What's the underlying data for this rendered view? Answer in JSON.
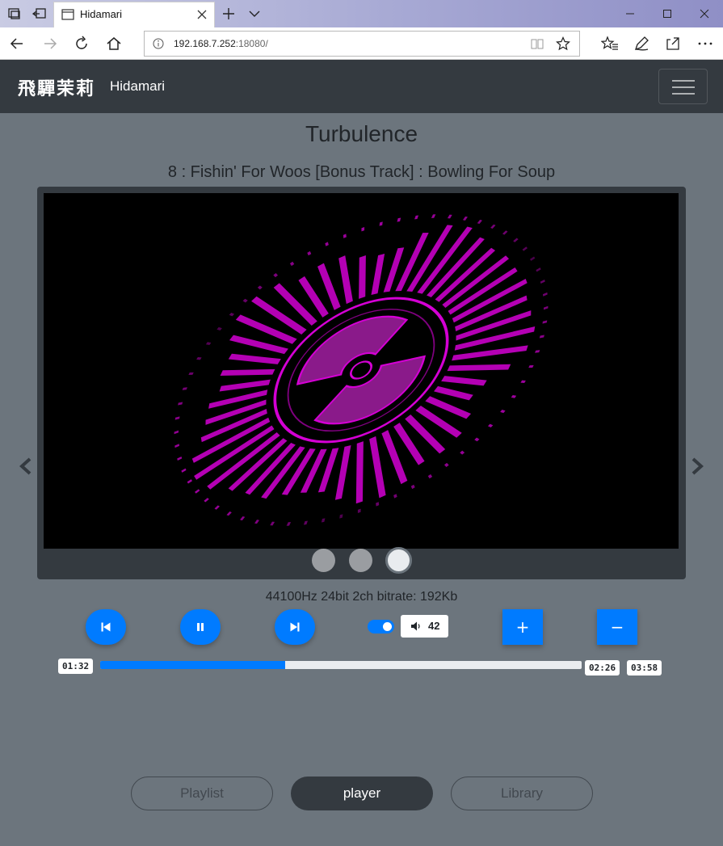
{
  "browser": {
    "tab_title": "Hidamari",
    "url_host": "192.168.7.252",
    "url_port": ":18080/",
    "icons": [
      "tab-manager-icon",
      "set-aside-tabs-icon",
      "page-icon",
      "close-icon",
      "plus-icon",
      "chevron-down-icon",
      "minimize-icon",
      "maximize-icon",
      "window-close-icon",
      "back-icon",
      "forward-icon",
      "refresh-icon",
      "home-icon",
      "info-icon",
      "reading-view-icon",
      "star-icon",
      "favorites-icon",
      "pen-icon",
      "share-icon",
      "more-icon"
    ]
  },
  "navbar": {
    "brand_kanji": "飛驒茉莉",
    "brand_name": "Hidamari",
    "menu_icon": "hamburger-icon"
  },
  "player": {
    "album": "Turbulence",
    "track": "8 : Fishin' For Woos [Bonus Track] : Bowling For Soup",
    "audio_info": "44100Hz 24bit 2ch bitrate: 192Kb",
    "volume": "42",
    "volume_toggle_on": true,
    "time_elapsed": "01:32",
    "time_remaining": "02:26",
    "time_total": "03:58",
    "progress": 0.385,
    "plus_label": "+",
    "minus_label": "−",
    "carousel_active_index": 2,
    "carousel_slide_count": 3
  },
  "tabs": {
    "playlist": "Playlist",
    "player": "player",
    "library": "Library"
  },
  "colors": {
    "page_bg": "#6c757d",
    "navbar_bg": "#343a40",
    "primary": "#007bff",
    "visualizer_accent": "#d400d4"
  }
}
